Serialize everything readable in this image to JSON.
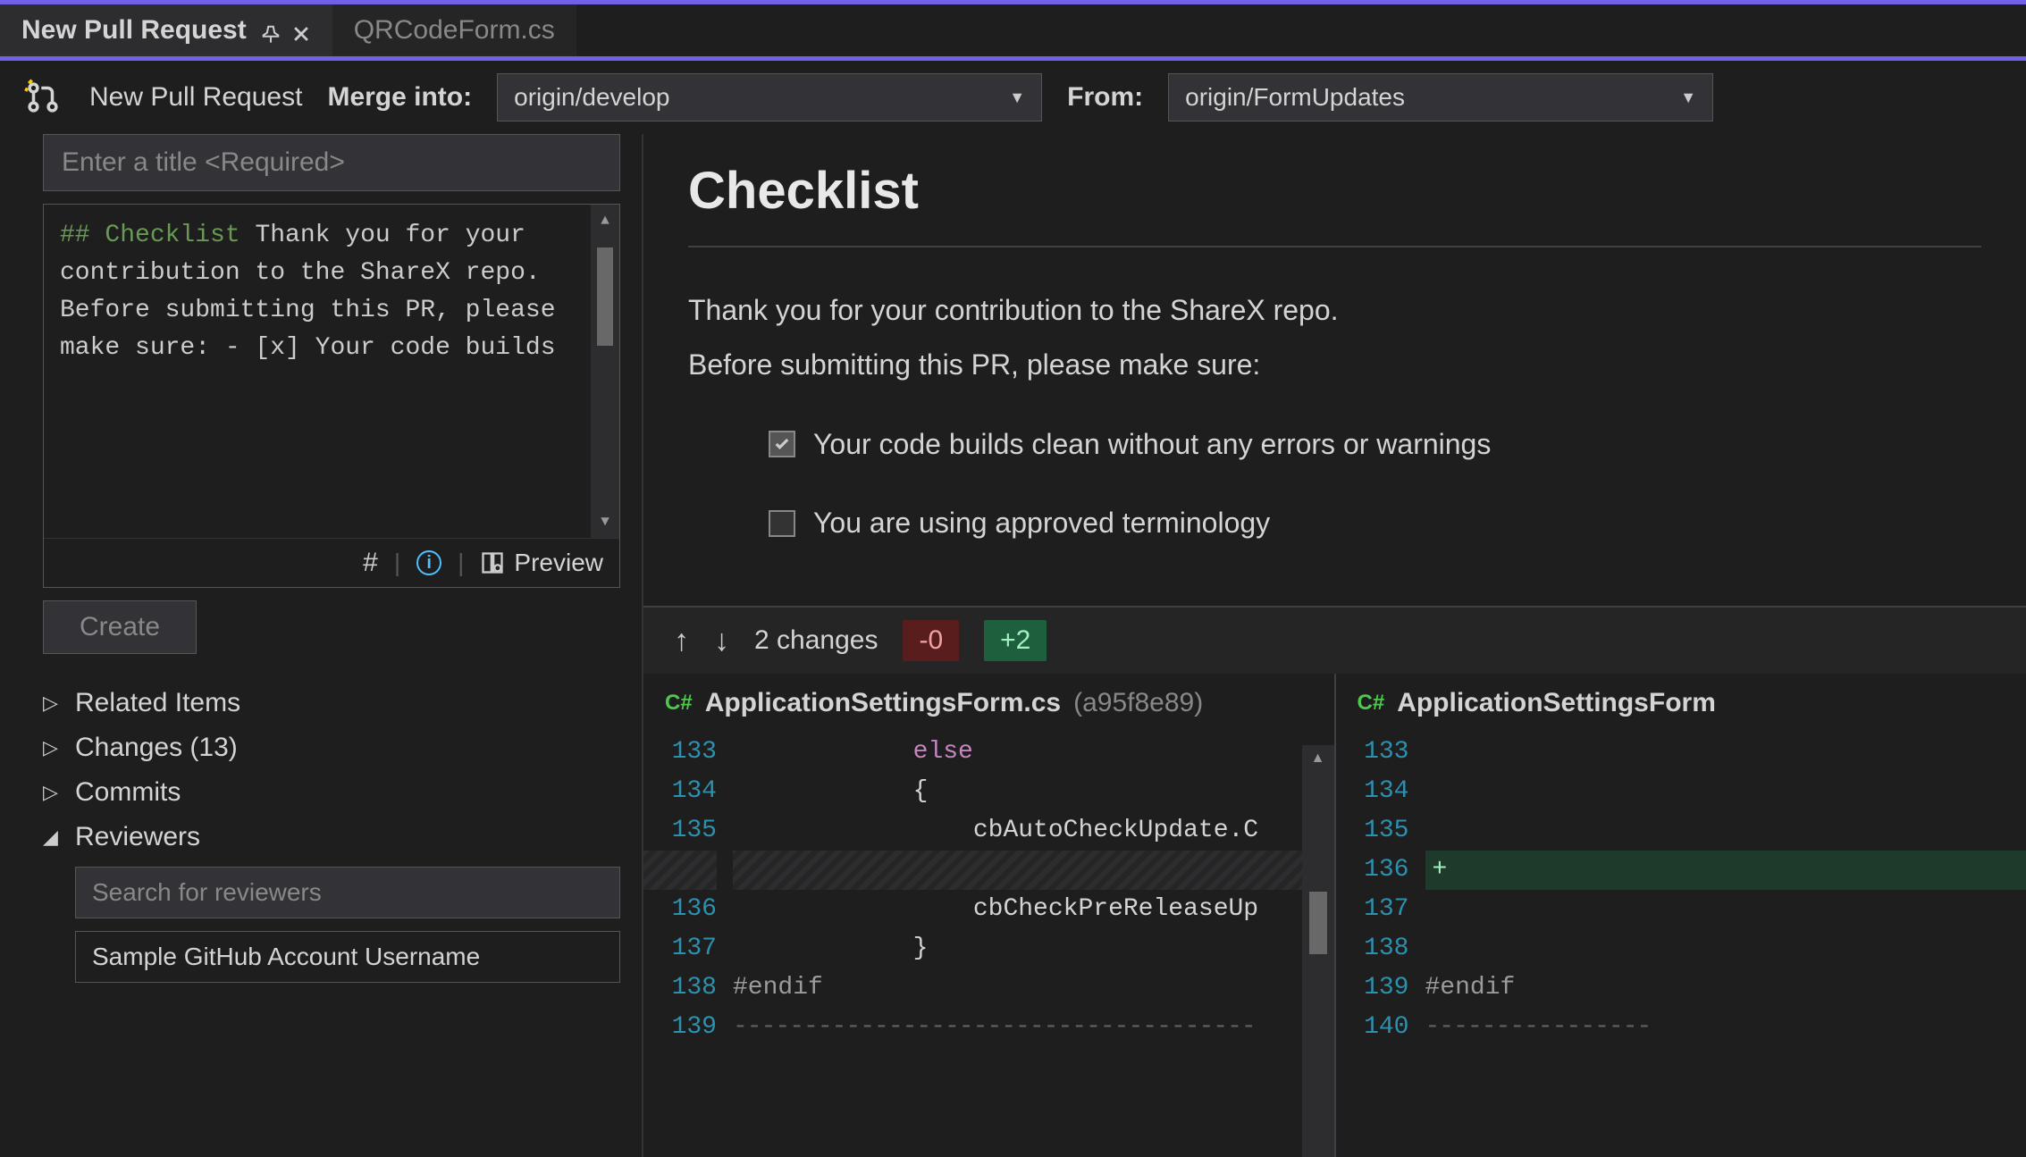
{
  "tabs": {
    "active": "New Pull Request",
    "inactive": "QRCodeForm.cs"
  },
  "toolbar": {
    "title": "New Pull Request",
    "merge_label": "Merge into:",
    "merge_value": "origin/develop",
    "from_label": "From:",
    "from_value": "origin/FormUpdates"
  },
  "pr": {
    "title_placeholder": "Enter a title <Required>",
    "description": "## Checklist\nThank you for your\ncontribution to the ShareX\n repo.\nBefore submitting this PR,\n please make sure:\n\n- [x] Your code builds",
    "preview_label": "Preview",
    "create_label": "Create"
  },
  "tree": {
    "related": "Related Items",
    "changes": "Changes (13)",
    "commits": "Commits",
    "reviewers": "Reviewers",
    "reviewer_search_placeholder": "Search for reviewers",
    "reviewer_sample": "Sample GitHub Account Username"
  },
  "preview": {
    "heading": "Checklist",
    "para1": "Thank you for your contribution to the ShareX repo.",
    "para2": "Before submitting this PR, please make sure:",
    "check1": "Your code builds clean without any errors or warnings",
    "check2": "You are using approved terminology"
  },
  "diff": {
    "changes_label": "2 changes",
    "minus": "-0",
    "plus": "+2",
    "file_left": "ApplicationSettingsForm.cs",
    "hash_left": "(a95f8e89)",
    "file_right": "ApplicationSettingsForm",
    "left_lines": [
      "133",
      "134",
      "135",
      "",
      "136",
      "137",
      "138",
      "139"
    ],
    "right_lines": [
      "133",
      "134",
      "135",
      "136",
      "137",
      "138",
      "139",
      "140"
    ],
    "code_left": {
      "l133": "else",
      "l134": "{",
      "l135": "cbAutoCheckUpdate.C",
      "l136": "cbCheckPreReleaseUp",
      "l137": "}",
      "l138": "#endif",
      "l139": "-------------------------------------"
    },
    "code_right": {
      "l139": "#endif",
      "l140": "----------------"
    }
  }
}
